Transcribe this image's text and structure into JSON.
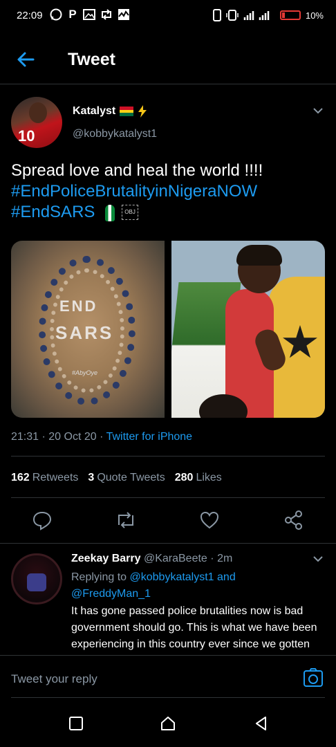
{
  "status_bar": {
    "time": "22:09",
    "app_icons": [
      "whatsapp-icon",
      "p-icon",
      "gallery-icon",
      "retweet-icon",
      "activity-icon"
    ],
    "battery": "10%"
  },
  "header": {
    "title": "Tweet"
  },
  "tweet": {
    "author_name": "Katalyst",
    "author_handle": "@kobbykatalyst1",
    "avatar_number": "10",
    "text_line1": "Spread love and heal the world !!!!",
    "hashtag1": "#EndPoliceBrutalityinNigeraNOW",
    "hashtag2": "#EndSARS",
    "obj_label": "OBJ",
    "image1_text_end": "END",
    "image1_text_sars": "SARS",
    "image1_watermark": "#AbyOye",
    "time": "21:31",
    "date": "20 Oct 20",
    "source": "Twitter for iPhone",
    "retweets_count": "162",
    "retweets_label": "Retweets",
    "quote_count": "3",
    "quote_label": "Quote Tweets",
    "likes_count": "280",
    "likes_label": "Likes"
  },
  "reply": {
    "name": "Zeekay Barry",
    "handle": "@KaraBeete",
    "time": "2m",
    "replying_prefix": "Replying to",
    "mention1": "@kobbykatalyst1",
    "and_word": "and",
    "mention2": "@FreddyMan_1",
    "text": "It has gone passed police brutalities now is bad government should go.  This is what we have been experiencing in this country ever since we gotten independence"
  },
  "reply_bar": {
    "placeholder": "Tweet your reply"
  },
  "colors": {
    "accent": "#1d9bf0",
    "muted": "#8b98a5",
    "background": "#000000",
    "battery": "#e53935"
  }
}
